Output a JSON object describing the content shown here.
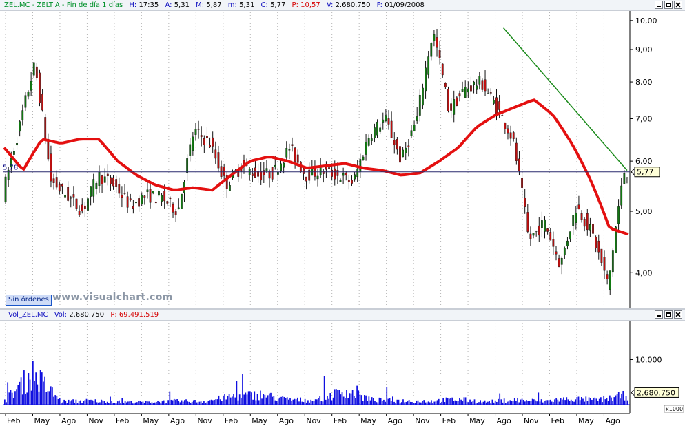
{
  "price_header": {
    "symbol": "ZEL.MC - ZELTIA - Fin de día 1 días",
    "time_label": "H:",
    "time": "17:35",
    "open_label": "A:",
    "open": "5,31",
    "high_label": "M:",
    "high": "5,87",
    "low_label": "m:",
    "low": "5,31",
    "close_label": "C:",
    "close": "5,77",
    "p_label": "P:",
    "p_value": "10,57",
    "vol_label": "V:",
    "vol_value": "2.680.750",
    "date_label": "F:",
    "date": "01/09/2008"
  },
  "volume_header": {
    "symbol": "Vol_ZEL.MC",
    "vol_label": "Vol:",
    "vol_value": "2.680.750",
    "p_label": "P:",
    "p_value": "69.491.519"
  },
  "order_button_label": "Sin órdenes",
  "watermark": "www.visualchart.com",
  "price_axis": {
    "ticks": [
      "10,00",
      "9,00",
      "8,00",
      "7,00",
      "6,00",
      "5,00",
      "4,00"
    ],
    "last_value": "5,77",
    "left_marker": "5,78"
  },
  "volume_axis": {
    "tick": "10.000",
    "last_value": "2.680.750",
    "multiplier": "x1000"
  },
  "x_axis_labels": [
    "Feb",
    "May",
    "Ago",
    "Nov",
    "Feb",
    "May",
    "Ago",
    "Nov",
    "Feb",
    "May",
    "Ago",
    "Nov",
    "Feb",
    "May",
    "Ago",
    "Nov",
    "Feb",
    "May",
    "Ago",
    "Nov",
    "Feb",
    "May",
    "Ago"
  ],
  "colors": {
    "moving_average": "#e41010",
    "trendline": "#1a8a1a",
    "candle_up": "#127a12",
    "candle_down": "#c01010",
    "volume": "#1010e0",
    "grid": "#b4b4b4",
    "last_line": "#2a2a6e"
  },
  "chart_data": [
    {
      "type": "line",
      "title": "ZEL.MC - ZELTIA - Fin de día 1 días",
      "xlabel": "",
      "ylabel": "",
      "y_scale": "log",
      "ylim": [
        3.55,
        10.3
      ],
      "x": [
        "Feb",
        "May",
        "Ago",
        "Nov",
        "Feb",
        "May",
        "Ago",
        "Nov",
        "Feb",
        "May",
        "Ago",
        "Nov",
        "Feb",
        "May",
        "Ago",
        "Nov",
        "Feb",
        "May",
        "Ago",
        "Nov",
        "Feb",
        "May",
        "Ago"
      ],
      "grid": true,
      "series": [
        {
          "role": "price",
          "values": [
            5.3,
            6.7,
            8.5,
            5.6,
            5.3,
            5.0,
            5.7,
            5.5,
            5.1,
            5.3,
            5.25,
            5.0,
            6.7,
            6.4,
            5.5,
            5.9,
            5.7,
            5.75,
            6.3,
            5.7,
            5.8,
            5.7,
            5.55,
            6.6,
            7.0,
            6.0,
            7.0,
            9.6,
            7.2,
            7.8,
            8.0,
            7.3,
            6.5,
            4.5,
            4.8,
            4.1,
            5.1,
            4.6,
            3.8,
            5.77
          ]
        },
        {
          "role": "moving_average",
          "values": [
            6.3,
            5.8,
            6.5,
            6.4,
            6.5,
            6.5,
            6.0,
            5.7,
            5.5,
            5.4,
            5.45,
            5.4,
            5.7,
            6.0,
            6.1,
            6.0,
            5.85,
            5.9,
            5.95,
            5.85,
            5.8,
            5.7,
            5.75,
            6.0,
            6.3,
            6.8,
            7.1,
            7.3,
            7.5,
            7.1,
            6.4,
            5.6,
            4.7,
            4.6
          ]
        },
        {
          "role": "trendline",
          "values": [
            9.75,
            5.8
          ]
        }
      ]
    },
    {
      "type": "bar",
      "title": "Vol_ZEL.MC",
      "categories": [
        "Feb",
        "May",
        "Ago",
        "Nov",
        "Feb",
        "May",
        "Ago",
        "Nov",
        "Feb",
        "May",
        "Ago",
        "Nov",
        "Feb",
        "May",
        "Ago",
        "Nov",
        "Feb",
        "May",
        "Ago",
        "Nov",
        "Feb",
        "May",
        "Ago"
      ],
      "values": [
        1200,
        8500,
        900,
        1100,
        800,
        700,
        1000,
        900,
        2200,
        2800,
        1400,
        1200,
        3800,
        1300,
        1100,
        1000,
        1500,
        800,
        1300,
        1000,
        1600,
        1300,
        2680.75
      ],
      "ylabel": "x1000",
      "ylim": [
        0,
        18000
      ]
    }
  ]
}
